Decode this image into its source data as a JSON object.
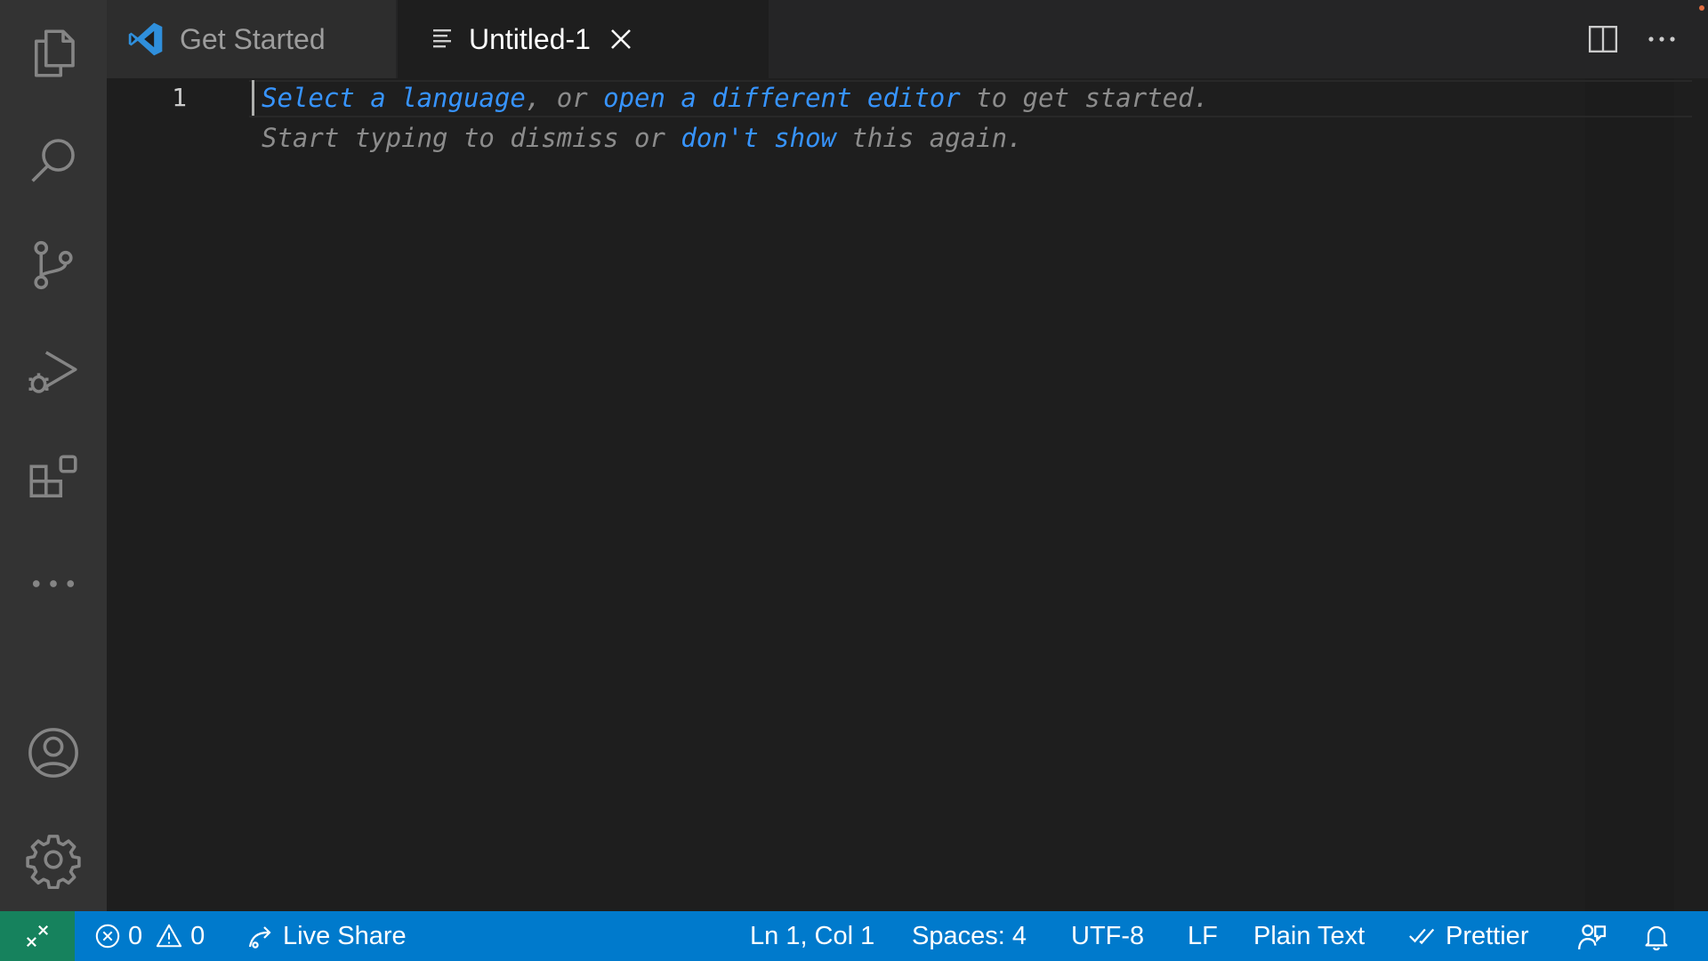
{
  "tabs": [
    {
      "label": "Get Started",
      "icon": "vscode-logo-icon",
      "active": false
    },
    {
      "label": "Untitled-1",
      "icon": "text-file-icon",
      "active": true
    }
  ],
  "activity_bar": {
    "items": [
      "explorer-icon",
      "search-icon",
      "source-control-icon",
      "run-debug-icon",
      "extensions-icon",
      "more-icon"
    ],
    "bottom": [
      "account-icon",
      "settings-gear-icon"
    ]
  },
  "editor": {
    "line_number": "1",
    "hint": {
      "select_language": "Select a language",
      "sep1": ", or ",
      "open_editor": "open a different editor",
      "sep2": " to get started.",
      "line2_start": "Start typing to dismiss or ",
      "dont_show": "don't show",
      "line2_end": " this again."
    }
  },
  "status_bar": {
    "errors": "0",
    "warnings": "0",
    "live_share": "Live Share",
    "position": "Ln 1, Col 1",
    "spaces": "Spaces: 4",
    "encoding": "UTF-8",
    "eol": "LF",
    "language": "Plain Text",
    "prettier": "Prettier"
  },
  "colors": {
    "status_bar": "#007acc",
    "remote": "#16825d",
    "link": "#3794ff",
    "vscode_logo": "#2f8fdc"
  }
}
